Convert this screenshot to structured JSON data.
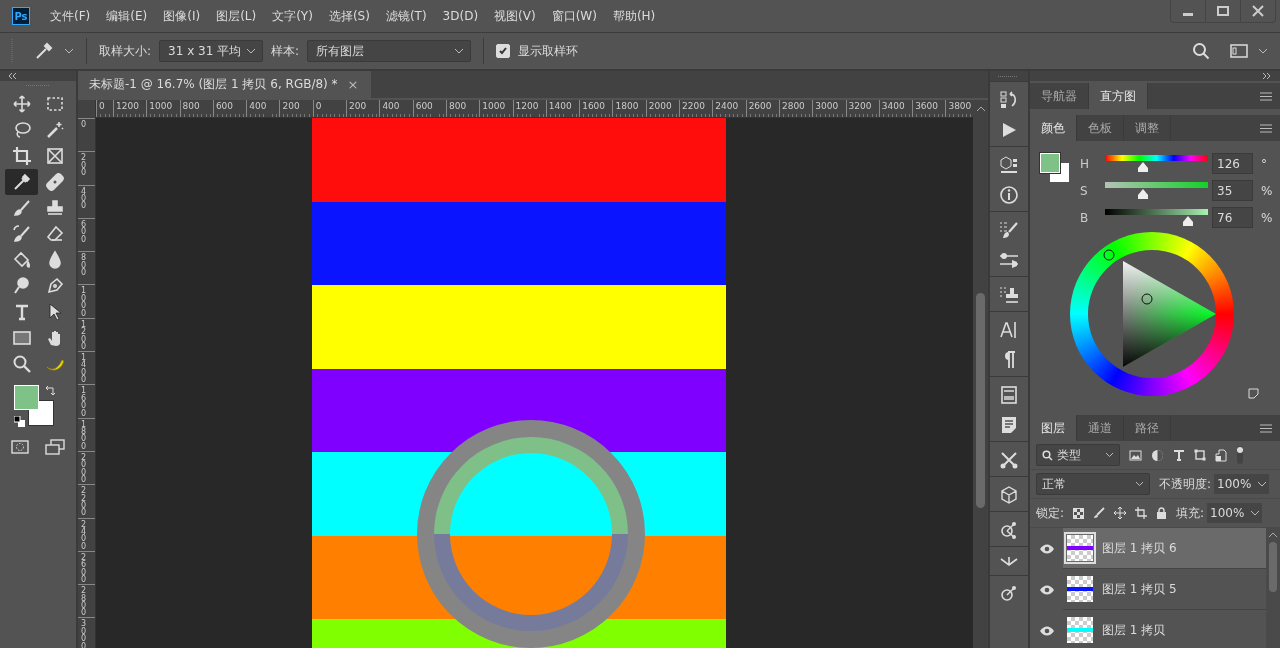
{
  "menu": {
    "logo": "Ps",
    "items": [
      "文件(F)",
      "编辑(E)",
      "图像(I)",
      "图层(L)",
      "文字(Y)",
      "选择(S)",
      "滤镜(T)",
      "3D(D)",
      "视图(V)",
      "窗口(W)",
      "帮助(H)"
    ]
  },
  "options": {
    "size_label": "取样大小:",
    "size_value": "31 x 31 平均",
    "sample_label": "样本:",
    "sample_value": "所有图层",
    "show_ring": {
      "label": "显示取样环",
      "checked": true
    }
  },
  "tools": [
    {
      "kind": "move",
      "selected": false
    },
    {
      "kind": "marquee",
      "selected": false
    },
    {
      "kind": "lasso",
      "selected": false
    },
    {
      "kind": "wand",
      "selected": false
    },
    {
      "kind": "crop",
      "selected": false
    },
    {
      "kind": "frame",
      "selected": false
    },
    {
      "kind": "eyedropper",
      "selected": true
    },
    {
      "kind": "healing",
      "selected": false
    },
    {
      "kind": "brush",
      "selected": false
    },
    {
      "kind": "stamp",
      "selected": false
    },
    {
      "kind": "history-brush",
      "selected": false
    },
    {
      "kind": "eraser",
      "selected": false
    },
    {
      "kind": "bucket",
      "selected": false
    },
    {
      "kind": "blur",
      "selected": false
    },
    {
      "kind": "dodge",
      "selected": false
    },
    {
      "kind": "pen",
      "selected": false
    },
    {
      "kind": "type",
      "selected": false
    },
    {
      "kind": "path-select",
      "selected": false
    },
    {
      "kind": "rectangle",
      "selected": false
    },
    {
      "kind": "hand",
      "selected": false
    },
    {
      "kind": "zoom",
      "selected": false
    },
    {
      "kind": "banana",
      "selected": false
    }
  ],
  "document": {
    "tab": {
      "title": "未标题-1 @ 16.7% (图层 1 拷贝 6, RGB/8) *",
      "close": "×"
    },
    "h_ruler": [
      "0",
      "1200",
      "1000",
      "800",
      "600",
      "400",
      "200",
      "0",
      "200",
      "400",
      "600",
      "800",
      "1000",
      "1200",
      "1400",
      "1600",
      "1800",
      "2000",
      "2200",
      "2400",
      "2600",
      "2800",
      "3000",
      "3200",
      "3400",
      "3600",
      "3800"
    ],
    "v_ruler": [
      "0",
      "200",
      "400",
      "600",
      "800",
      "1000",
      "1200",
      "1400",
      "1600",
      "1800",
      "2000",
      "2200",
      "2400",
      "2600",
      "2800",
      "3000"
    ],
    "stripes": [
      {
        "color": "#ff0d0d"
      },
      {
        "color": "#0a14ff"
      },
      {
        "color": "#ffff00"
      },
      {
        "color": "#8000ff"
      },
      {
        "color": "#00ffff"
      },
      {
        "color": "#ff8000"
      },
      {
        "color": "#80ff00"
      }
    ]
  },
  "panels": {
    "top_tabs": [
      {
        "label": "导航器",
        "selected": false
      },
      {
        "label": "直方图",
        "selected": true
      }
    ],
    "color": {
      "tabs": [
        {
          "label": "颜色",
          "selected": true
        },
        {
          "label": "色板",
          "selected": false
        },
        {
          "label": "调整",
          "selected": false
        }
      ],
      "sliders": [
        {
          "kind": "hue",
          "label": "H",
          "level": 0.35,
          "value": "126",
          "unit": "°"
        },
        {
          "kind": "saturation",
          "label": "S",
          "level": 0.35,
          "value": "35",
          "unit": "%"
        },
        {
          "kind": "brightness",
          "label": "B",
          "level": 0.76,
          "value": "76",
          "unit": "%"
        }
      ]
    },
    "layers": {
      "tabs": [
        {
          "label": "图层",
          "selected": true
        },
        {
          "label": "通道",
          "selected": false
        },
        {
          "label": "路径",
          "selected": false
        }
      ],
      "filter": "类型",
      "blend": "正常",
      "opacity_label": "不透明度:",
      "opacity": "100%",
      "lock_label": "锁定:",
      "fill_label": "填充:",
      "fill": "100%",
      "items": [
        {
          "name": "图层 1 拷贝 6",
          "visible": true,
          "selected": true,
          "color": "#8000ff"
        },
        {
          "name": "图层 1 拷贝 5",
          "visible": true,
          "selected": false,
          "color": "#0a14ff"
        },
        {
          "name": "图层 1 拷贝",
          "visible": true,
          "selected": false,
          "color": "#00ffff"
        }
      ]
    }
  }
}
